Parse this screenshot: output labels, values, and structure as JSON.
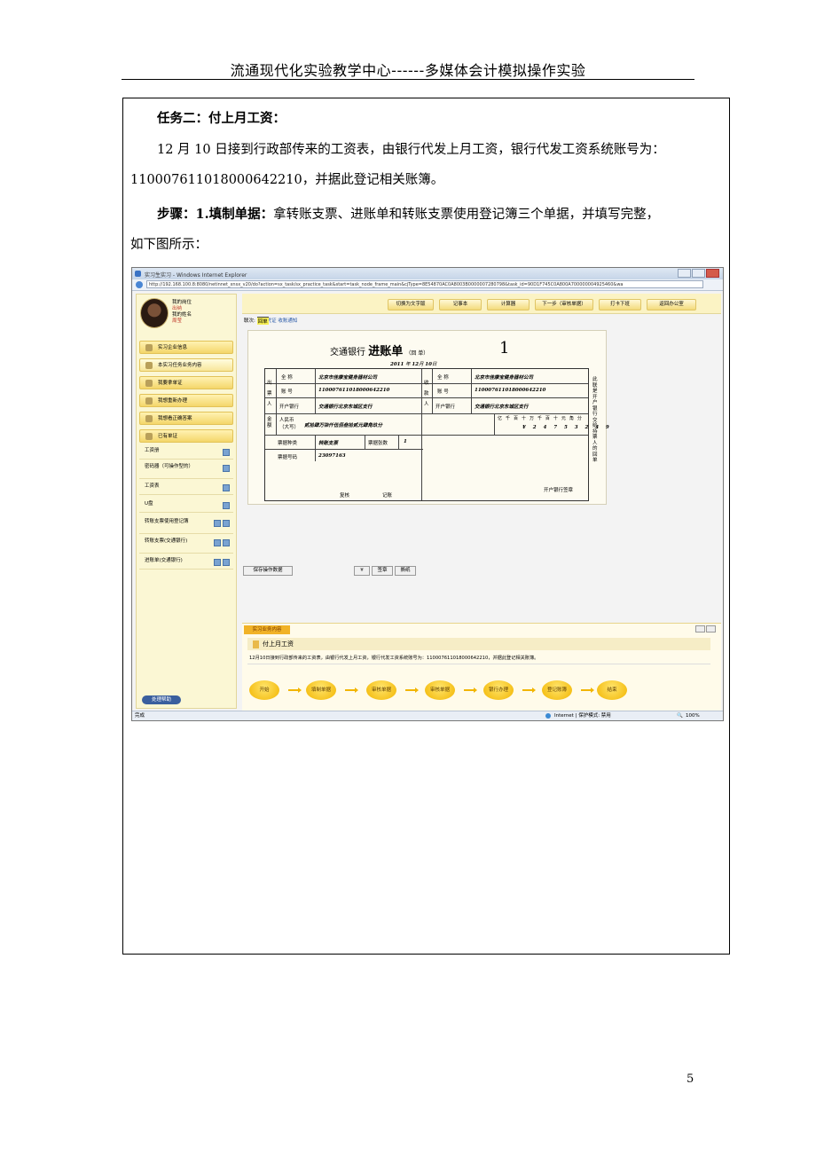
{
  "header": {
    "title": "流通现代化实验教学中心------多媒体会计模拟操作实验"
  },
  "content": {
    "task_title": "任务二：付上月工资：",
    "para1_line1": "12 月 10 日接到行政部传来的工资表，由银行代发上月工资，银行代发工资系统账号为：",
    "para1_line2": "11000761101800064221​0，并据此登记相关账簿。",
    "step_label": "步骤：1.填制单据：",
    "step_text": "拿转账支票、进账单和转账支票使用登记簿三个单据，并填写完整，",
    "step_line2": "如下图所示："
  },
  "screenshot": {
    "window_title": "实习生实习 - Windows Internet Explorer",
    "url": "http://192.168.100.8:8080/netinnet_xnsx_v20/do?action=sx_task/sx_practice_task&start=task_node_frame_main&cjType=8E54870AC0A8003B0000007280798&task_id=90D1F745C0A800A700000004925460&wa",
    "user": {
      "position_label": "我的岗位",
      "position": "出纳",
      "name_label": "我的姓名",
      "name": "周莹"
    },
    "nav": [
      {
        "label": "实习企业信息"
      },
      {
        "label": "本实习任务业务内容"
      },
      {
        "label": "我要拿单证"
      },
      {
        "label": "我想重新办理"
      },
      {
        "label": "我想看正确答案"
      },
      {
        "label": "已有单证"
      }
    ],
    "docs": [
      {
        "label": "工资册"
      },
      {
        "label": "密码器（可操作型的）"
      },
      {
        "label": "工资表"
      },
      {
        "label": "U盘"
      },
      {
        "label": "转账支票使用登记簿"
      },
      {
        "label": "转账支票(交通银行)"
      },
      {
        "label": "进账单(交通银行)"
      }
    ],
    "footer_btn": "处理帮助",
    "toolbar": [
      "切换为文字版",
      "记事本",
      "计算器",
      "下一步（审核单据）",
      "打卡下班",
      "返回办公室"
    ],
    "tabs": {
      "prefix": "联次:",
      "t1": "回单",
      "t2": "贷方凭证",
      "t3": "收账通知"
    },
    "voucher": {
      "bank": "交通银行",
      "title": "进账单",
      "sub": "（回  单）",
      "num": "1",
      "year": "2011",
      "y_label": "年",
      "month": "12",
      "m_label": "月",
      "day": "10",
      "d_label": "日",
      "payer_label": "出票人",
      "payee_label": "收款人",
      "full_name_label": "全  称",
      "account_label": "账  号",
      "bank_label": "开户银行",
      "payer_name": "北京市佳康宝健身器材公司",
      "payer_account": "11000761101800064221​0",
      "payer_bank": "交通银行北京东城区支行",
      "payee_name": "北京市佳康宝健身器材公司",
      "payee_account": "11000761101800064221​0",
      "payee_bank": "交通银行北京东城区支行",
      "amount_label": "金额",
      "rmb_label": "人民币（大写）",
      "amount_words": "贰拾肆万柒仟伍佰叁拾贰元肆角玖分",
      "digit_headers": "亿 千 百 十 万 千 百 十 元 角 分",
      "digits": "¥ 2 4 7 5 3 2 4 9",
      "ticket_type_label": "票据种类",
      "ticket_type": "转账支票",
      "ticket_count_label": "票据张数",
      "ticket_count": "1",
      "ticket_no_label": "票据号码",
      "ticket_no": "23097163",
      "review_label": "复核",
      "record_label": "记账",
      "bank_sign": "开户银行签章",
      "side_note": "此联是开户银行交给持票人的回单"
    },
    "save_btn": "保存操作数据",
    "yen_btn": "¥",
    "sign_btn": "签章",
    "clear_btn": "撕纸",
    "panel": {
      "tab": "实习业务内容",
      "heading": "付上月工资",
      "desc": "12月10日接到行政部传来的工资表，由银行代发上月工资，银行代发工资系统账号为：11000761101800064221​0，并据此登记相关账簿。",
      "flow": [
        "开始",
        "填制单据",
        "审核单据",
        "审核单据",
        "银行办理",
        "登记账簿",
        "结束"
      ]
    },
    "status": {
      "left": "完成",
      "mid": "Internet | 保护模式: 禁用",
      "zoom": "100%"
    }
  },
  "page_number": "5"
}
